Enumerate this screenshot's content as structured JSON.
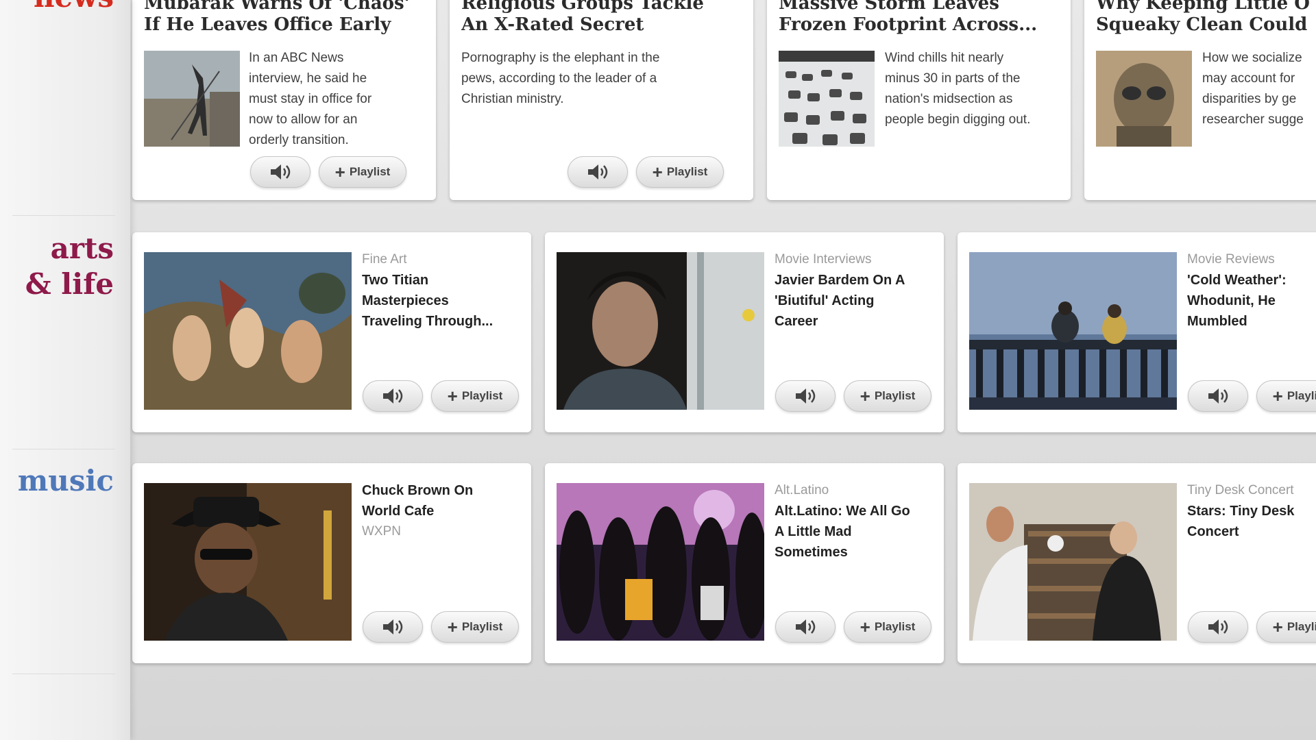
{
  "sections": {
    "news": [
      "news"
    ],
    "arts": [
      "arts",
      "& life"
    ],
    "music": [
      "music"
    ]
  },
  "buttons": {
    "playlist_label": "Playlist",
    "playlist_icon": "plus-icon",
    "audio_icon": "speaker-icon"
  },
  "colors": {
    "news": "#d52b1e",
    "arts": "#8e1a4a",
    "music": "#4f78b9"
  },
  "news_stories": [
    {
      "headline": [
        "Mubarak Warns Of 'Chaos'",
        "If He Leaves Office Early"
      ],
      "has_image": true,
      "teaser": [
        "In an ABC News",
        "interview, he said he",
        "must stay in office for",
        "now to allow for an",
        "orderly transition."
      ]
    },
    {
      "headline": [
        "Religious Groups Tackle",
        "An X-Rated Secret"
      ],
      "has_image": false,
      "teaser": [
        "Pornography is the elephant in the",
        "pews, according to the leader of a",
        "Christian ministry."
      ]
    },
    {
      "headline": [
        "Massive Storm Leaves",
        "Frozen Footprint Across..."
      ],
      "has_image": true,
      "teaser": [
        "Wind chills hit nearly",
        "minus 30 in parts of the",
        "nation's midsection as",
        "people begin digging out."
      ]
    },
    {
      "headline": [
        "Why Keeping Little O",
        "Squeaky Clean Could"
      ],
      "has_image": true,
      "teaser": [
        "How we socialize",
        "may account for",
        "disparities by ge",
        "researcher sugge"
      ]
    }
  ],
  "arts_stories": [
    {
      "category": "Fine Art",
      "title": [
        "Two Titian",
        "Masterpieces",
        "Traveling Through..."
      ]
    },
    {
      "category": "Movie Interviews",
      "title": [
        "Javier Bardem On A",
        "'Biutiful' Acting",
        "Career"
      ]
    },
    {
      "category": "Movie Reviews",
      "title": [
        "'Cold Weather':",
        "Whodunit, He",
        "Mumbled"
      ]
    }
  ],
  "music_stories": [
    {
      "category": "",
      "title": [
        "Chuck Brown On",
        "World Cafe"
      ],
      "source": "WXPN"
    },
    {
      "category": "Alt.Latino",
      "title": [
        "Alt.Latino: We All Go",
        "A Little Mad",
        "Sometimes"
      ]
    },
    {
      "category": "Tiny Desk Concert",
      "title": [
        "Stars: Tiny Desk",
        "Concert"
      ]
    }
  ]
}
